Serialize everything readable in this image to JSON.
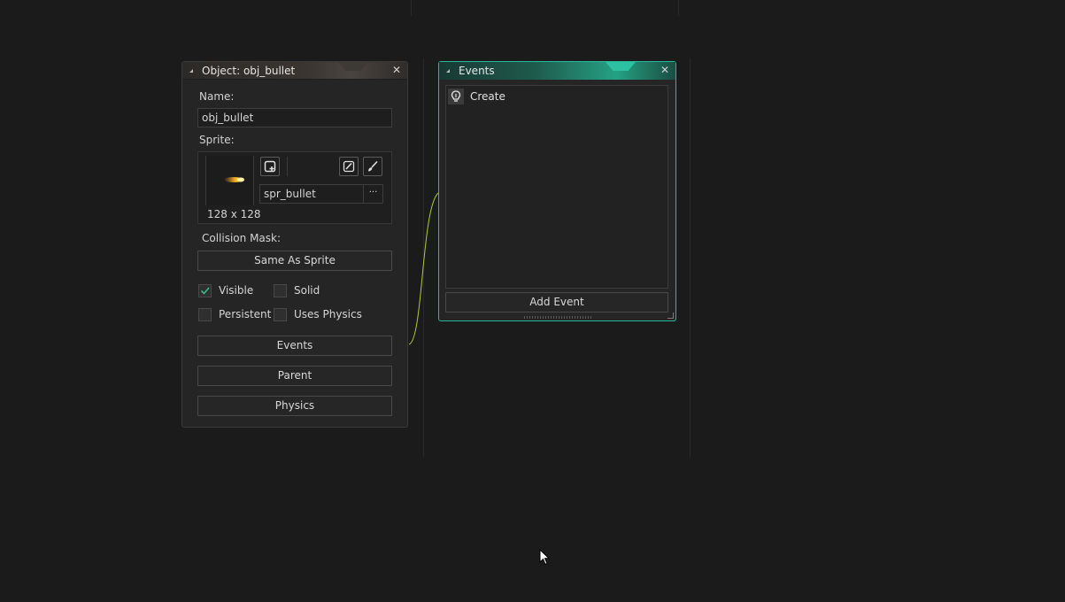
{
  "object_window": {
    "title": "Object: obj_bullet",
    "name_label": "Name:",
    "name_value": "obj_bullet",
    "sprite_label": "Sprite:",
    "sprite_size": "128 x 128",
    "sprite_name": "spr_bullet",
    "sprite_browse_label": "···",
    "collision_label": "Collision Mask:",
    "collision_value": "Same As Sprite",
    "checkboxes": {
      "visible": {
        "label": "Visible",
        "checked": true
      },
      "solid": {
        "label": "Solid",
        "checked": false
      },
      "persistent": {
        "label": "Persistent",
        "checked": false
      },
      "uses_physics": {
        "label": "Uses Physics",
        "checked": false
      }
    },
    "buttons": {
      "events": "Events",
      "parent": "Parent",
      "physics": "Physics"
    },
    "close_symbol": "✕"
  },
  "events_window": {
    "title": "Events",
    "events": [
      {
        "label": "Create",
        "icon": "lightbulb-icon"
      }
    ],
    "add_event_label": "Add Event",
    "close_symbol": "✕"
  },
  "colors": {
    "background": "#1b1b1b",
    "panel": "#252525",
    "events_accent": "#2bb59a",
    "check_color": "#35c08a",
    "connector": "#b3c93a"
  }
}
